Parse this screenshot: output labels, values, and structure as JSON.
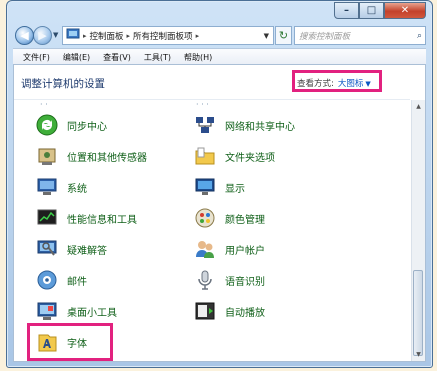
{
  "window": {
    "caption_buttons": {
      "minimize": "–",
      "maximize": "□",
      "close": "✕"
    }
  },
  "nav": {
    "back": "◀",
    "forward": "▶",
    "breadcrumb": [
      "控制面板",
      "所有控制面板项"
    ],
    "refresh": "↻",
    "search_placeholder": "搜索控制面板"
  },
  "menu": [
    "文件(F)",
    "编辑(E)",
    "查看(V)",
    "工具(T)",
    "帮助(H)"
  ],
  "content": {
    "title": "调整计算机的设置",
    "view_by_label": "查看方式:",
    "view_by_value": "大图标",
    "items": [
      {
        "label": "同步中心",
        "icon": "sync-center-icon"
      },
      {
        "label": "网络和共享中心",
        "icon": "network-icon"
      },
      {
        "label": "位置和其他传感器",
        "icon": "location-sensor-icon"
      },
      {
        "label": "文件夹选项",
        "icon": "folder-options-icon"
      },
      {
        "label": "系统",
        "icon": "system-icon"
      },
      {
        "label": "显示",
        "icon": "display-icon"
      },
      {
        "label": "性能信息和工具",
        "icon": "performance-icon"
      },
      {
        "label": "颜色管理",
        "icon": "color-management-icon"
      },
      {
        "label": "疑难解答",
        "icon": "troubleshooting-icon"
      },
      {
        "label": "用户帐户",
        "icon": "user-accounts-icon"
      },
      {
        "label": "邮件",
        "icon": "mail-icon"
      },
      {
        "label": "语音识别",
        "icon": "speech-icon"
      },
      {
        "label": "桌面小工具",
        "icon": "gadgets-icon"
      },
      {
        "label": "自动播放",
        "icon": "autoplay-icon"
      },
      {
        "label": "字体",
        "icon": "fonts-icon"
      }
    ]
  },
  "colors": {
    "highlight": "#e2217f",
    "link_green": "#0e5f17",
    "title_blue": "#1f3b6e"
  }
}
